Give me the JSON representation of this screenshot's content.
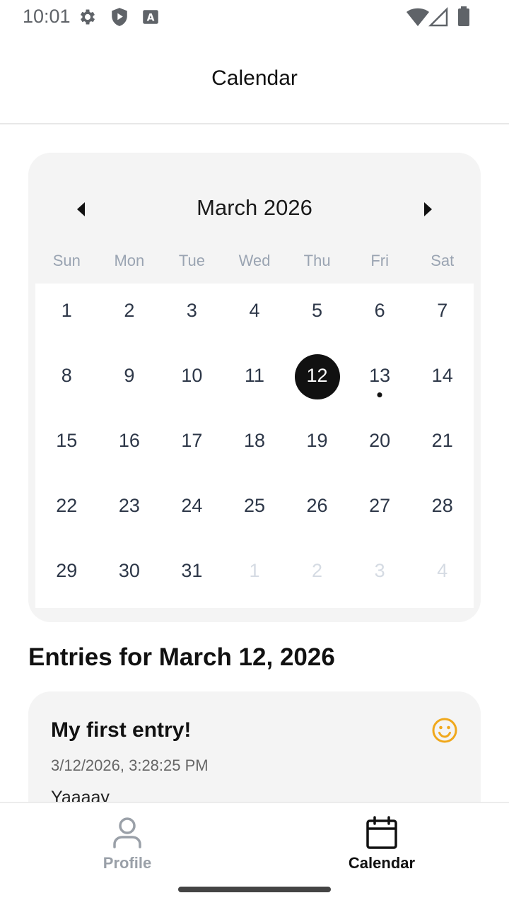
{
  "status_bar": {
    "time": "10:01",
    "left_icons": [
      "settings-icon",
      "play-protect-icon",
      "keyboard-a-icon"
    ],
    "right_icons": [
      "wifi-icon",
      "signal-icon",
      "battery-icon"
    ]
  },
  "header": {
    "title": "Calendar"
  },
  "calendar": {
    "month_label": "March 2026",
    "prev_icon": "triangle-left-icon",
    "next_icon": "triangle-right-icon",
    "weekdays": [
      "Sun",
      "Mon",
      "Tue",
      "Wed",
      "Thu",
      "Fri",
      "Sat"
    ],
    "days": [
      {
        "label": "1"
      },
      {
        "label": "2"
      },
      {
        "label": "3"
      },
      {
        "label": "4"
      },
      {
        "label": "5"
      },
      {
        "label": "6"
      },
      {
        "label": "7"
      },
      {
        "label": "8"
      },
      {
        "label": "9"
      },
      {
        "label": "10"
      },
      {
        "label": "11"
      },
      {
        "label": "12",
        "selected": true
      },
      {
        "label": "13",
        "has_entry": true
      },
      {
        "label": "14"
      },
      {
        "label": "15"
      },
      {
        "label": "16"
      },
      {
        "label": "17"
      },
      {
        "label": "18"
      },
      {
        "label": "19"
      },
      {
        "label": "20"
      },
      {
        "label": "21"
      },
      {
        "label": "22"
      },
      {
        "label": "23"
      },
      {
        "label": "24"
      },
      {
        "label": "25"
      },
      {
        "label": "26"
      },
      {
        "label": "27"
      },
      {
        "label": "28"
      },
      {
        "label": "29"
      },
      {
        "label": "30"
      },
      {
        "label": "31"
      },
      {
        "label": "1",
        "other_month": true
      },
      {
        "label": "2",
        "other_month": true
      },
      {
        "label": "3",
        "other_month": true
      },
      {
        "label": "4",
        "other_month": true
      }
    ],
    "selected_color": "#111111",
    "weekday_color": "#9aa4b2"
  },
  "entries": {
    "heading": "Entries for March 12, 2026",
    "items": [
      {
        "title": "My first entry!",
        "timestamp": "3/12/2026, 3:28:25 PM",
        "body": "Yaaaay",
        "mood_icon": "smiley-face-icon",
        "mood_color": "#f0a81c"
      }
    ]
  },
  "bottom_nav": {
    "items": [
      {
        "label": "Profile",
        "icon": "person-icon",
        "active": false
      },
      {
        "label": "Calendar",
        "icon": "calendar-icon",
        "active": true
      }
    ]
  }
}
